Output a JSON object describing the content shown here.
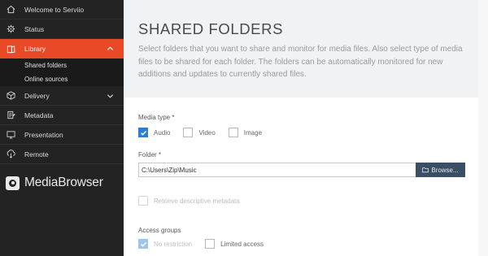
{
  "sidebar": {
    "items": [
      {
        "label": "Welcome to Serviio",
        "icon": "home-icon"
      },
      {
        "label": "Status",
        "icon": "gear-icon"
      },
      {
        "label": "Library",
        "icon": "library-icon",
        "active": true
      },
      {
        "label": "Delivery",
        "icon": "cube-icon"
      },
      {
        "label": "Metadata",
        "icon": "metadata-icon"
      },
      {
        "label": "Presentation",
        "icon": "presentation-icon"
      },
      {
        "label": "Remote",
        "icon": "remote-icon"
      }
    ],
    "library_subitems": [
      "Shared folders",
      "Online sources"
    ],
    "logo_text": "MediaBrowser"
  },
  "header": {
    "title": "SHARED FOLDERS",
    "description": "Select folders that you want to share and monitor for media files. Also select type of media files to be shared for each folder. The folders can be automatically monitored for new additions and updates to currently shared files."
  },
  "form": {
    "media_type_label": "Media type *",
    "media_types": [
      {
        "label": "Audio",
        "checked": true
      },
      {
        "label": "Video",
        "checked": false
      },
      {
        "label": "Image",
        "checked": false
      }
    ],
    "folder_label": "Folder *",
    "folder_value": "C:\\Users\\Zip\\Music",
    "browse_label": "Browse...",
    "retrieve_metadata_label": "Retrieve descriptive metadata",
    "access_groups_label": "Access groups",
    "access_groups": [
      {
        "label": "No restriction",
        "checked": true
      },
      {
        "label": "Limited access",
        "checked": false
      }
    ]
  },
  "colors": {
    "sidebar_bg": "#232323",
    "accent": "#e84a27",
    "checkbox_blue": "#2a7fd4",
    "browse_button": "#3a4f63"
  }
}
